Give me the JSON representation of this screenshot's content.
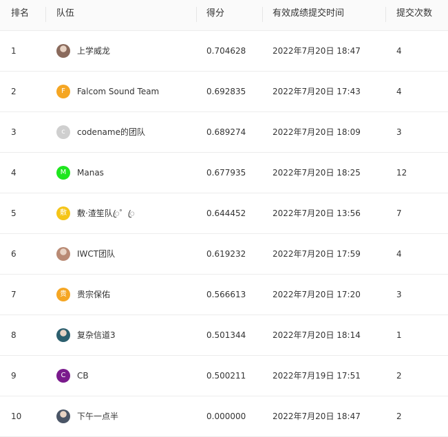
{
  "header": {
    "rank": "排名",
    "team": "队伍",
    "score": "得分",
    "time": "有效成绩提交时间",
    "count": "提交次数"
  },
  "rows": [
    {
      "rank": "1",
      "team": "上学威龙",
      "avatar_letter": "",
      "avatar_color": "#8a6a5c",
      "avatar_icon": "photo-avatar-icon",
      "score": "0.704628",
      "time": "2022年7月20日 18:47",
      "count": "4"
    },
    {
      "rank": "2",
      "team": "Falcom Sound Team",
      "avatar_letter": "F",
      "avatar_color": "#f5a623",
      "score": "0.692835",
      "time": "2022年7月20日 17:43",
      "count": "4"
    },
    {
      "rank": "3",
      "team": "codename的团队",
      "avatar_letter": "c",
      "avatar_color": "#cfcfcf",
      "score": "0.689274",
      "time": "2022年7月20日 18:09",
      "count": "3"
    },
    {
      "rank": "4",
      "team": "Manas",
      "avatar_letter": "M",
      "avatar_color": "#1ee61e",
      "score": "0.677935",
      "time": "2022年7月20日 18:25",
      "count": "12"
    },
    {
      "rank": "5",
      "team": "敷·渣笙队ꦿ゜ꦿ",
      "avatar_letter": "敷",
      "avatar_color": "#f5c518",
      "score": "0.644452",
      "time": "2022年7月20日 13:56",
      "count": "7"
    },
    {
      "rank": "6",
      "team": "IWCT团队",
      "avatar_letter": "",
      "avatar_color": "#b98a74",
      "avatar_icon": "photo-avatar-icon",
      "score": "0.619232",
      "time": "2022年7月20日 17:59",
      "count": "4"
    },
    {
      "rank": "7",
      "team": "贵宗保佑",
      "avatar_letter": "贵",
      "avatar_color": "#f5a623",
      "score": "0.566613",
      "time": "2022年7月20日 17:20",
      "count": "3"
    },
    {
      "rank": "8",
      "team": "复杂信道3",
      "avatar_letter": "",
      "avatar_color": "#2c5f6e",
      "avatar_icon": "photo-avatar-icon",
      "score": "0.501344",
      "time": "2022年7月20日 18:14",
      "count": "1"
    },
    {
      "rank": "9",
      "team": "CB",
      "avatar_letter": "C",
      "avatar_color": "#7a1a8c",
      "score": "0.500211",
      "time": "2022年7月19日 17:51",
      "count": "2"
    },
    {
      "rank": "10",
      "team": "下午一点半",
      "avatar_letter": "",
      "avatar_color": "#4a5566",
      "avatar_icon": "photo-avatar-icon",
      "score": "0.000000",
      "time": "2022年7月20日 18:47",
      "count": "2"
    }
  ]
}
